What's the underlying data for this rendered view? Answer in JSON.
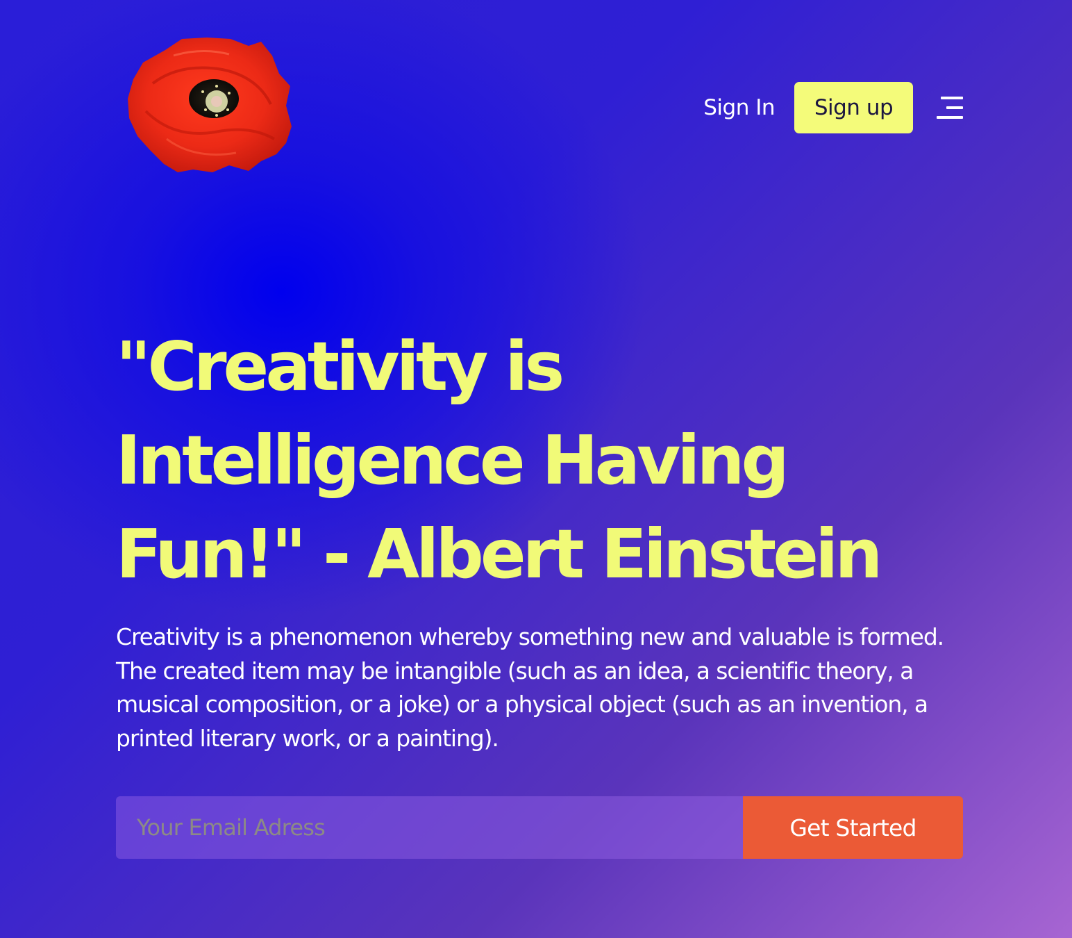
{
  "header": {
    "logo_icon": "red-poppy-flower",
    "signin_label": "Sign In",
    "signup_label": "Sign up",
    "menu_icon": "menu-icon"
  },
  "hero": {
    "headline": "\"Creativity is Intelligence Having Fun!\" - Albert Einstein",
    "description": "Creativity is a phenomenon whereby something new and valuable is formed. The created item may be intangible (such as an idea, a scientific theory, a musical composition, or a joke) or a physical object (such as an invention, a printed literary work, or a painting).",
    "email_placeholder": "Your Email Adress",
    "cta_label": "Get Started"
  },
  "colors": {
    "accent_yellow": "#f1fa78",
    "cta_orange": "#eb5a36",
    "background_blue": "#0000ee",
    "background_purple": "#a765d2"
  }
}
